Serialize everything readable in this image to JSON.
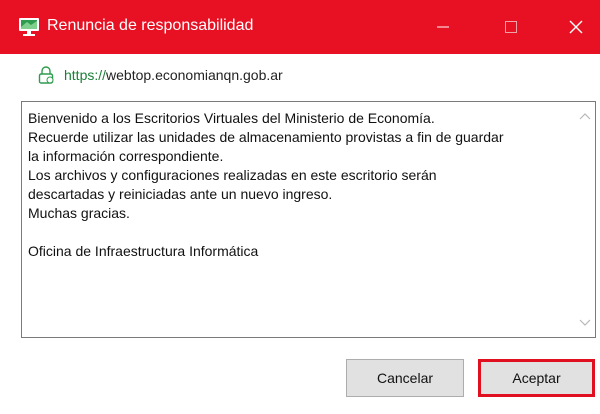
{
  "window": {
    "title": "Renuncia de responsabilidad",
    "titlebar_color": "#e81123"
  },
  "address": {
    "icon": "lock-icon",
    "scheme": "https://",
    "host": "webtop.economianqn.gob.ar"
  },
  "message": {
    "lines": [
      "Bienvenido a los Escritorios Virtuales del Ministerio de Economía.",
      "Recuerde utilizar las unidades de almacenamiento provistas a fin de guardar",
      "la información correspondiente.",
      "Los archivos y configuraciones realizadas en este escritorio serán",
      "descartadas y reiniciadas ante un nuevo ingreso.",
      "Muchas gracias.",
      "",
      "Oficina de Infraestructura Informática"
    ]
  },
  "buttons": {
    "cancel_label": "Cancelar",
    "accept_label": "Aceptar"
  }
}
